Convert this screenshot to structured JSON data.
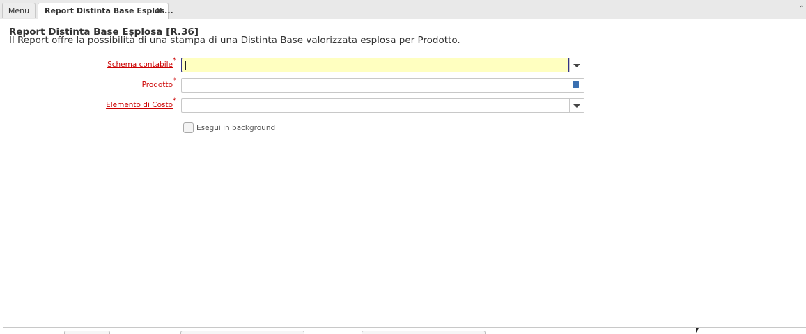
{
  "tabs": {
    "menu_label": "Menu",
    "report_label": "Report Distinta Base Esplos...",
    "close_symbol": "✖"
  },
  "page": {
    "title": "Report Distinta Base Esplosa [R.36]",
    "description": "Il Report offre la possibilità di una stampa di una Distinta Base valorizzata esplosa per Prodotto."
  },
  "form": {
    "required_marker": "*",
    "fields": [
      {
        "label": "Schema contabile",
        "value": "",
        "control": "dropdown"
      },
      {
        "label": "Prodotto",
        "value": "",
        "control": "search"
      },
      {
        "label": "Elemento di Costo",
        "value": "",
        "control": "dropdown"
      }
    ],
    "background_checkbox": {
      "label": "Esegui in background",
      "checked": false
    }
  },
  "colors": {
    "required_label": "#cc0000",
    "active_field_bg": "#ffffc0",
    "search_icon": "#3a6fb0"
  },
  "icons": {
    "dropdown": "chevron-down-icon",
    "search": "book-icon",
    "close": "close-icon",
    "collapse": "collapse-icon"
  }
}
